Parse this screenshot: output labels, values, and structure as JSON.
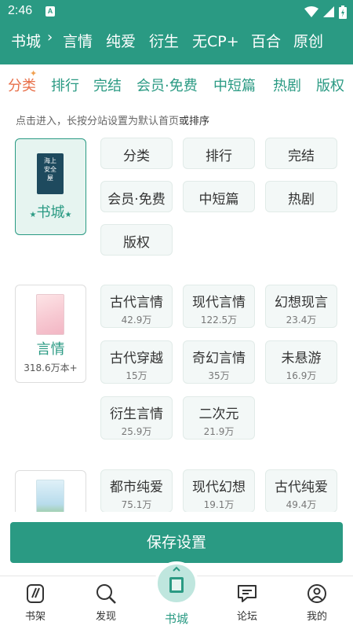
{
  "status": {
    "time": "2:46",
    "notification": "A"
  },
  "header": {
    "title": "书城",
    "sites": [
      "言情",
      "纯爱",
      "衍生",
      "无CP+",
      "百合",
      "原创"
    ]
  },
  "tabs": [
    "分类",
    "排行",
    "完结",
    "会员·免费",
    "中短篇",
    "热剧",
    "版权"
  ],
  "hint": {
    "text": "点击进入，长按分站设置为默认首页",
    "emphasis": "或排序"
  },
  "home_card": {
    "book_title": "海上安全屋",
    "label": "书城"
  },
  "home_chips": [
    "分类",
    "排行",
    "完结",
    "会员·免费",
    "中短篇",
    "热剧",
    "版权"
  ],
  "yanqing_card": {
    "label": "言情",
    "count": "318.6万本+"
  },
  "yanqing_chips": [
    {
      "label": "古代言情",
      "count": "42.9万"
    },
    {
      "label": "现代言情",
      "count": "122.5万"
    },
    {
      "label": "幻想现言",
      "count": "23.4万"
    },
    {
      "label": "古代穿越",
      "count": "15万"
    },
    {
      "label": "奇幻言情",
      "count": "35万"
    },
    {
      "label": "未悬游",
      "count": "16.9万"
    },
    {
      "label": "衍生言情",
      "count": "25.9万"
    },
    {
      "label": "二次元",
      "count": "21.9万"
    }
  ],
  "chunai_chips": [
    {
      "label": "都市纯爱",
      "count": "75.1万"
    },
    {
      "label": "现代幻想",
      "count": "19.1万"
    },
    {
      "label": "古代纯爱",
      "count": "49.4万"
    }
  ],
  "save_button": "保存设置",
  "bottom_nav": [
    "书架",
    "发现",
    "书城",
    "论坛",
    "我的"
  ],
  "colors": {
    "primary": "#2a9a83",
    "accent": "#e8704a"
  }
}
